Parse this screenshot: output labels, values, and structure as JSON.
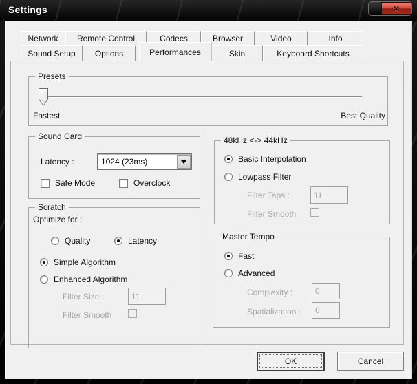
{
  "window": {
    "title": "Settings",
    "close_glyph": "✕"
  },
  "tabs": {
    "row1": [
      {
        "label": "Network"
      },
      {
        "label": "Remote Control"
      },
      {
        "label": "Codecs"
      },
      {
        "label": "Browser"
      },
      {
        "label": "Video"
      },
      {
        "label": "Info"
      }
    ],
    "row2": [
      {
        "label": "Sound Setup"
      },
      {
        "label": "Options"
      },
      {
        "label": "Performances",
        "active": true
      },
      {
        "label": "Skin"
      },
      {
        "label": "Keyboard Shortcuts"
      }
    ],
    "active_tab": "Performances"
  },
  "presets": {
    "title": "Presets",
    "min_label": "Fastest",
    "max_label": "Best Quality",
    "slider_position": "min"
  },
  "sound_card": {
    "title": "Sound Card",
    "latency_label": "Latency :",
    "latency_value": "1024 (23ms)",
    "safe_mode": {
      "label": "Safe Mode",
      "checked": false
    },
    "overclock": {
      "label": "Overclock",
      "checked": false
    }
  },
  "scratch": {
    "title": "Scratch",
    "optimize_label": "Optimize for :",
    "quality": {
      "label": "Quality",
      "selected": false
    },
    "latency": {
      "label": "Latency",
      "selected": true
    },
    "simple": {
      "label": "Simple Algorithm",
      "selected": true
    },
    "enhanced": {
      "label": "Enhanced Algorithm",
      "selected": false
    },
    "filter_size_label": "Filter Size :",
    "filter_size_value": "11",
    "filter_smooth_label": "Filter Smooth",
    "filter_smooth_checked": false
  },
  "resample": {
    "title": "48kHz <-> 44kHz",
    "basic": {
      "label": "Basic Interpolation",
      "selected": true
    },
    "lowpass": {
      "label": "Lowpass Filter",
      "selected": false
    },
    "filter_taps_label": "Filter Taps :",
    "filter_taps_value": "11",
    "filter_smooth_label": "Filter Smooth",
    "filter_smooth_checked": false
  },
  "master_tempo": {
    "title": "Master Tempo",
    "fast": {
      "label": "Fast",
      "selected": true
    },
    "advanced": {
      "label": "Advanced",
      "selected": false
    },
    "complexity_label": "Complexity :",
    "complexity_value": "0",
    "spatialization_label": "Spatialization :",
    "spatialization_value": "0"
  },
  "actions": {
    "ok": "OK",
    "cancel": "Cancel"
  },
  "colors": {
    "titlebar": "#0a0a0a",
    "body": "#f0f0f0",
    "close_red": "#b5291c",
    "disabled_text": "#a6a6a6"
  }
}
